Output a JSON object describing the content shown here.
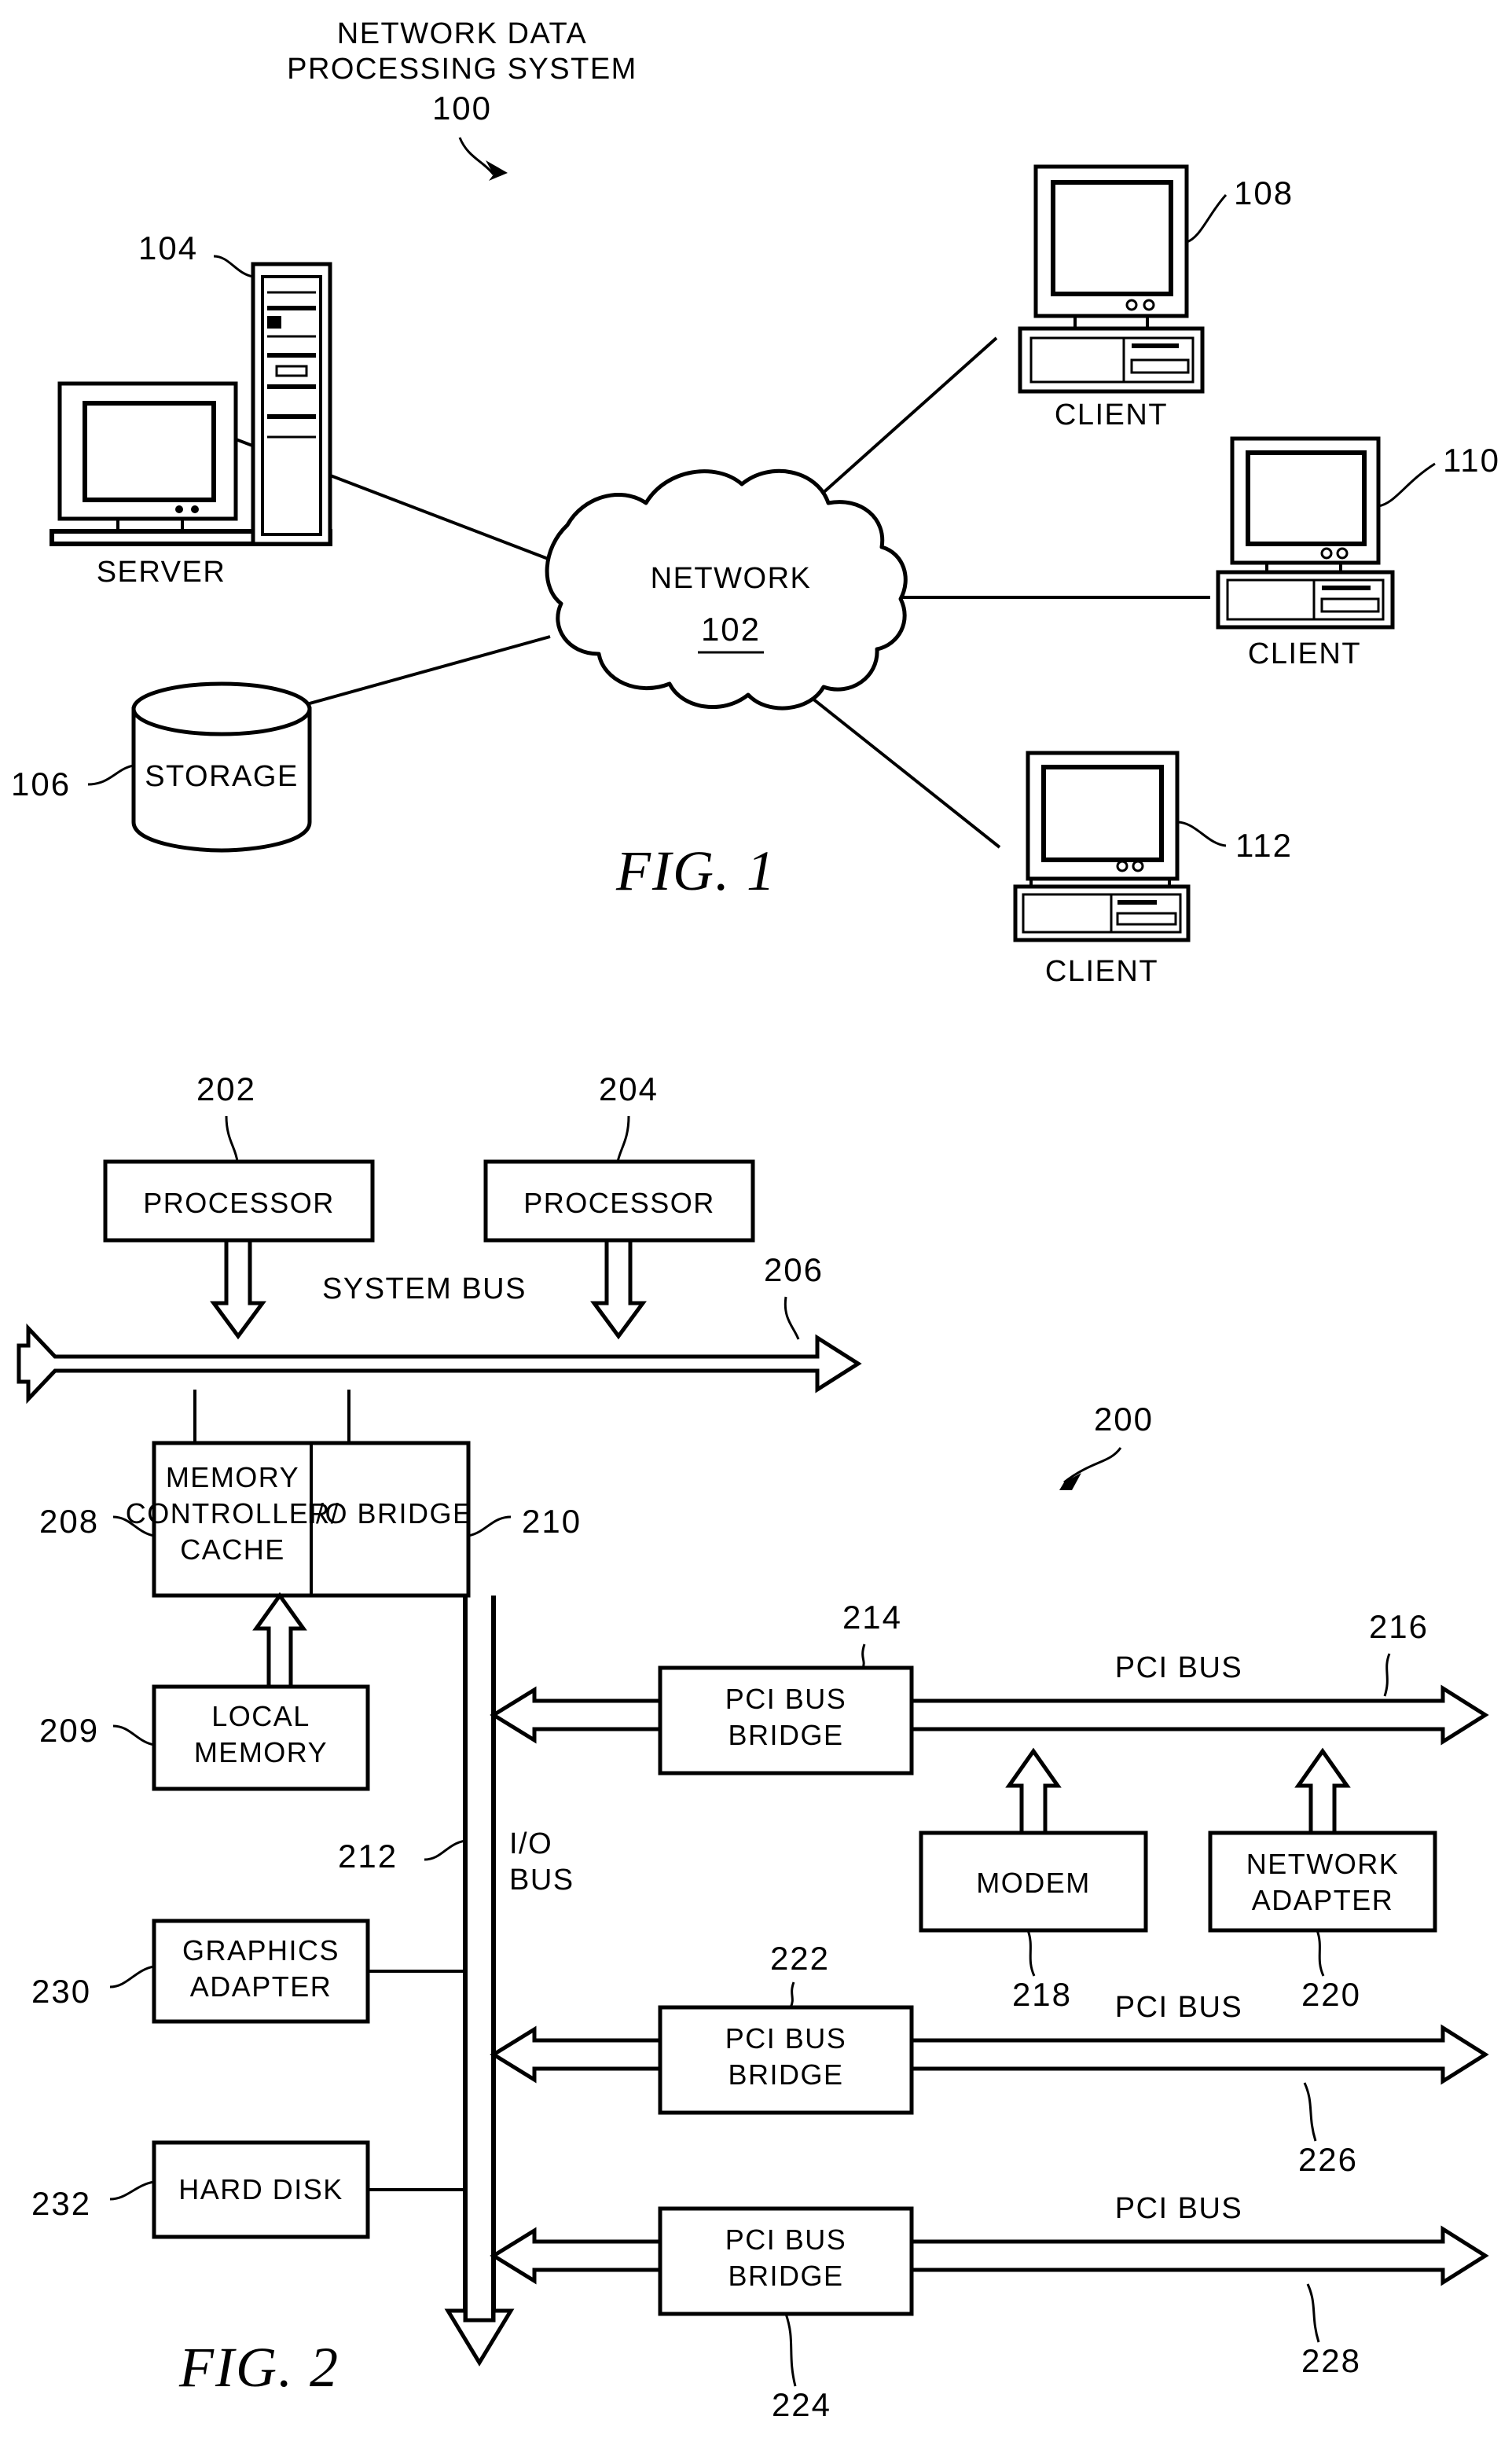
{
  "document": {
    "type": "patent-drawing-sheet",
    "figure_count": 2
  },
  "figure1": {
    "caption": "FIG.  1",
    "title_line1": "NETWORK DATA",
    "title_line2": "PROCESSING SYSTEM",
    "title_ref": "100",
    "network": {
      "label": "NETWORK",
      "ref": "102"
    },
    "server": {
      "label": "SERVER",
      "ref": "104"
    },
    "storage": {
      "label": "STORAGE",
      "ref": "106"
    },
    "clients": [
      {
        "label": "CLIENT",
        "ref": "108"
      },
      {
        "label": "CLIENT",
        "ref": "110"
      },
      {
        "label": "CLIENT",
        "ref": "112"
      }
    ]
  },
  "figure2": {
    "caption": "FIG.  2",
    "system_ref": "200",
    "processors": [
      {
        "label": "PROCESSOR",
        "ref": "202"
      },
      {
        "label": "PROCESSOR",
        "ref": "204"
      }
    ],
    "system_bus": {
      "label": "SYSTEM BUS",
      "ref": "206"
    },
    "memory_controller": {
      "line1": "MEMORY",
      "line2": "CONTROLLER/",
      "line3": "CACHE",
      "ref": "208"
    },
    "io_bridge": {
      "label": "I/O BRIDGE",
      "ref": "210"
    },
    "local_memory": {
      "line1": "LOCAL",
      "line2": "MEMORY",
      "ref": "209"
    },
    "io_bus": {
      "line1": "I/O",
      "line2": "BUS",
      "ref": "212"
    },
    "graphics_adapter": {
      "line1": "GRAPHICS",
      "line2": "ADAPTER",
      "ref": "230"
    },
    "hard_disk": {
      "label": "HARD  DISK",
      "ref": "232"
    },
    "pci_bridges": [
      {
        "line1": "PCI BUS",
        "line2": "BRIDGE",
        "ref": "214",
        "bus_label": "PCI BUS",
        "bus_ref": "216"
      },
      {
        "line1": "PCI BUS",
        "line2": "BRIDGE",
        "ref": "222",
        "bus_label": "PCI BUS",
        "bus_ref": "226"
      },
      {
        "line1": "PCI BUS",
        "line2": "BRIDGE",
        "ref": "224",
        "bus_label": "PCI BUS",
        "bus_ref": "228"
      }
    ],
    "modem": {
      "label": "MODEM",
      "ref": "218"
    },
    "network_adapter": {
      "line1": "NETWORK",
      "line2": "ADAPTER",
      "ref": "220"
    }
  },
  "colors": {
    "ink": "#000000",
    "paper": "#ffffff"
  }
}
